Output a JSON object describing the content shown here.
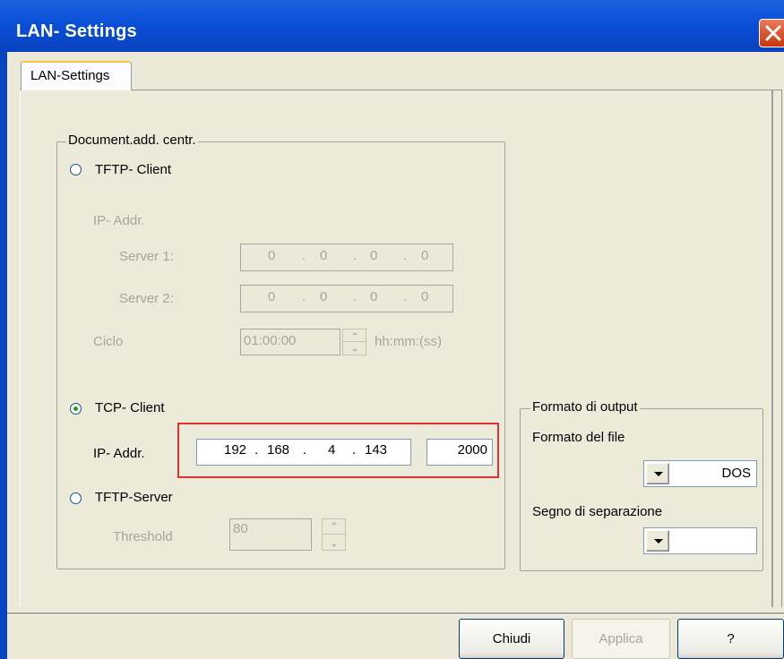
{
  "window": {
    "title": "LAN- Settings",
    "close_icon": "close-icon"
  },
  "tabs": [
    {
      "label": "LAN-Settings",
      "active": true
    }
  ],
  "document_group": {
    "title": "Document.add. centr.",
    "tftp_client": {
      "label": "TFTP- Client",
      "checked": false,
      "ip_addr_label": "IP- Addr.",
      "server1_label": "Server 1:",
      "server1_octets": [
        "0",
        "0",
        "0",
        "0"
      ],
      "server2_label": "Server 2:",
      "server2_octets": [
        "0",
        "0",
        "0",
        "0"
      ],
      "ciclo_label": "Ciclo",
      "ciclo_value": "01:00:00",
      "ciclo_unit": "hh:mm:(ss)"
    },
    "tcp_client": {
      "label": "TCP- Client",
      "checked": true,
      "ip_addr_label": "IP- Addr.",
      "ip_octets": [
        "192",
        "168",
        "4",
        "143"
      ],
      "port": "2000"
    },
    "tftp_server": {
      "label": "TFTP-Server",
      "checked": false,
      "threshold_label": "Threshold",
      "threshold_value": "80"
    }
  },
  "output_group": {
    "title": "Formato di output",
    "file_format_label": "Formato del file",
    "file_format_value": "DOS",
    "separator_label": "Segno di separazione",
    "separator_value": ""
  },
  "buttons": {
    "close_label": "Chiudi",
    "apply_label": "Applica",
    "help_label": "?"
  },
  "colors": {
    "titlebar": "#0a4fd6",
    "highlight": "#e23030",
    "radio_checked": "#21a121"
  }
}
